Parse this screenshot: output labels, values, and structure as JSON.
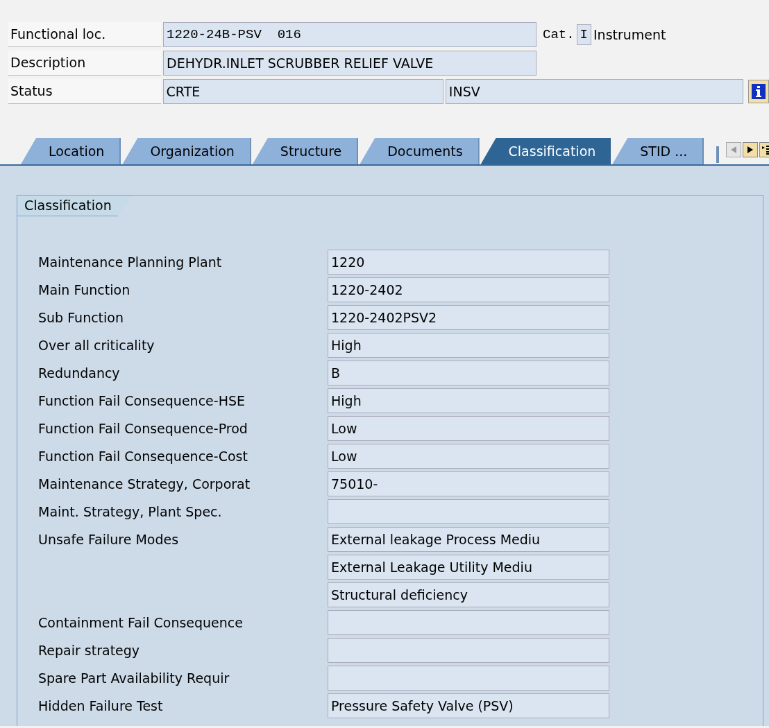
{
  "header": {
    "functional_loc": {
      "label": "Functional loc.",
      "value": "1220-24B-PSV  016",
      "cat_label": "Cat.",
      "cat_value": "I",
      "cat_text": "Instrument"
    },
    "description": {
      "label": "Description",
      "value": "DEHYDR.INLET SCRUBBER RELIEF VALVE"
    },
    "status": {
      "label": "Status",
      "value_1": "CRTE",
      "value_2": "INSV"
    }
  },
  "tabs": [
    {
      "label": "Location",
      "selected": false
    },
    {
      "label": "Organization",
      "selected": false
    },
    {
      "label": "Structure",
      "selected": false
    },
    {
      "label": "Documents",
      "selected": false
    },
    {
      "label": "Classification",
      "selected": true
    },
    {
      "label": "STID ...",
      "selected": false
    }
  ],
  "group": {
    "title": "Classification",
    "rows": [
      {
        "label": "Maintenance Planning Plant",
        "value": "1220"
      },
      {
        "label": "Main Function",
        "value": "1220-2402"
      },
      {
        "label": "Sub Function",
        "value": "1220-2402PSV2"
      },
      {
        "label": "Over all criticality",
        "value": "High"
      },
      {
        "label": "Redundancy",
        "value": "B"
      },
      {
        "label": "Function Fail Consequence-HSE",
        "value": "High"
      },
      {
        "label": "Function Fail Consequence-Prod",
        "value": "Low"
      },
      {
        "label": "Function Fail Consequence-Cost",
        "value": "Low"
      },
      {
        "label": "Maintenance Strategy, Corporat",
        "value": "75010-"
      },
      {
        "label": "Maint. Strategy, Plant  Spec."
      },
      {
        "label": "Unsafe Failure Modes",
        "value": "External leakage Process Mediu"
      },
      {
        "value": "External Leakage Utility Mediu"
      },
      {
        "value": "Structural deficiency"
      },
      {
        "label": "Containment Fail Consequence"
      },
      {
        "label": "Repair strategy"
      },
      {
        "label": "Spare Part Availability Requir"
      },
      {
        "label": "Hidden Failure Test",
        "value": "Pressure Safety Valve (PSV)"
      }
    ]
  }
}
